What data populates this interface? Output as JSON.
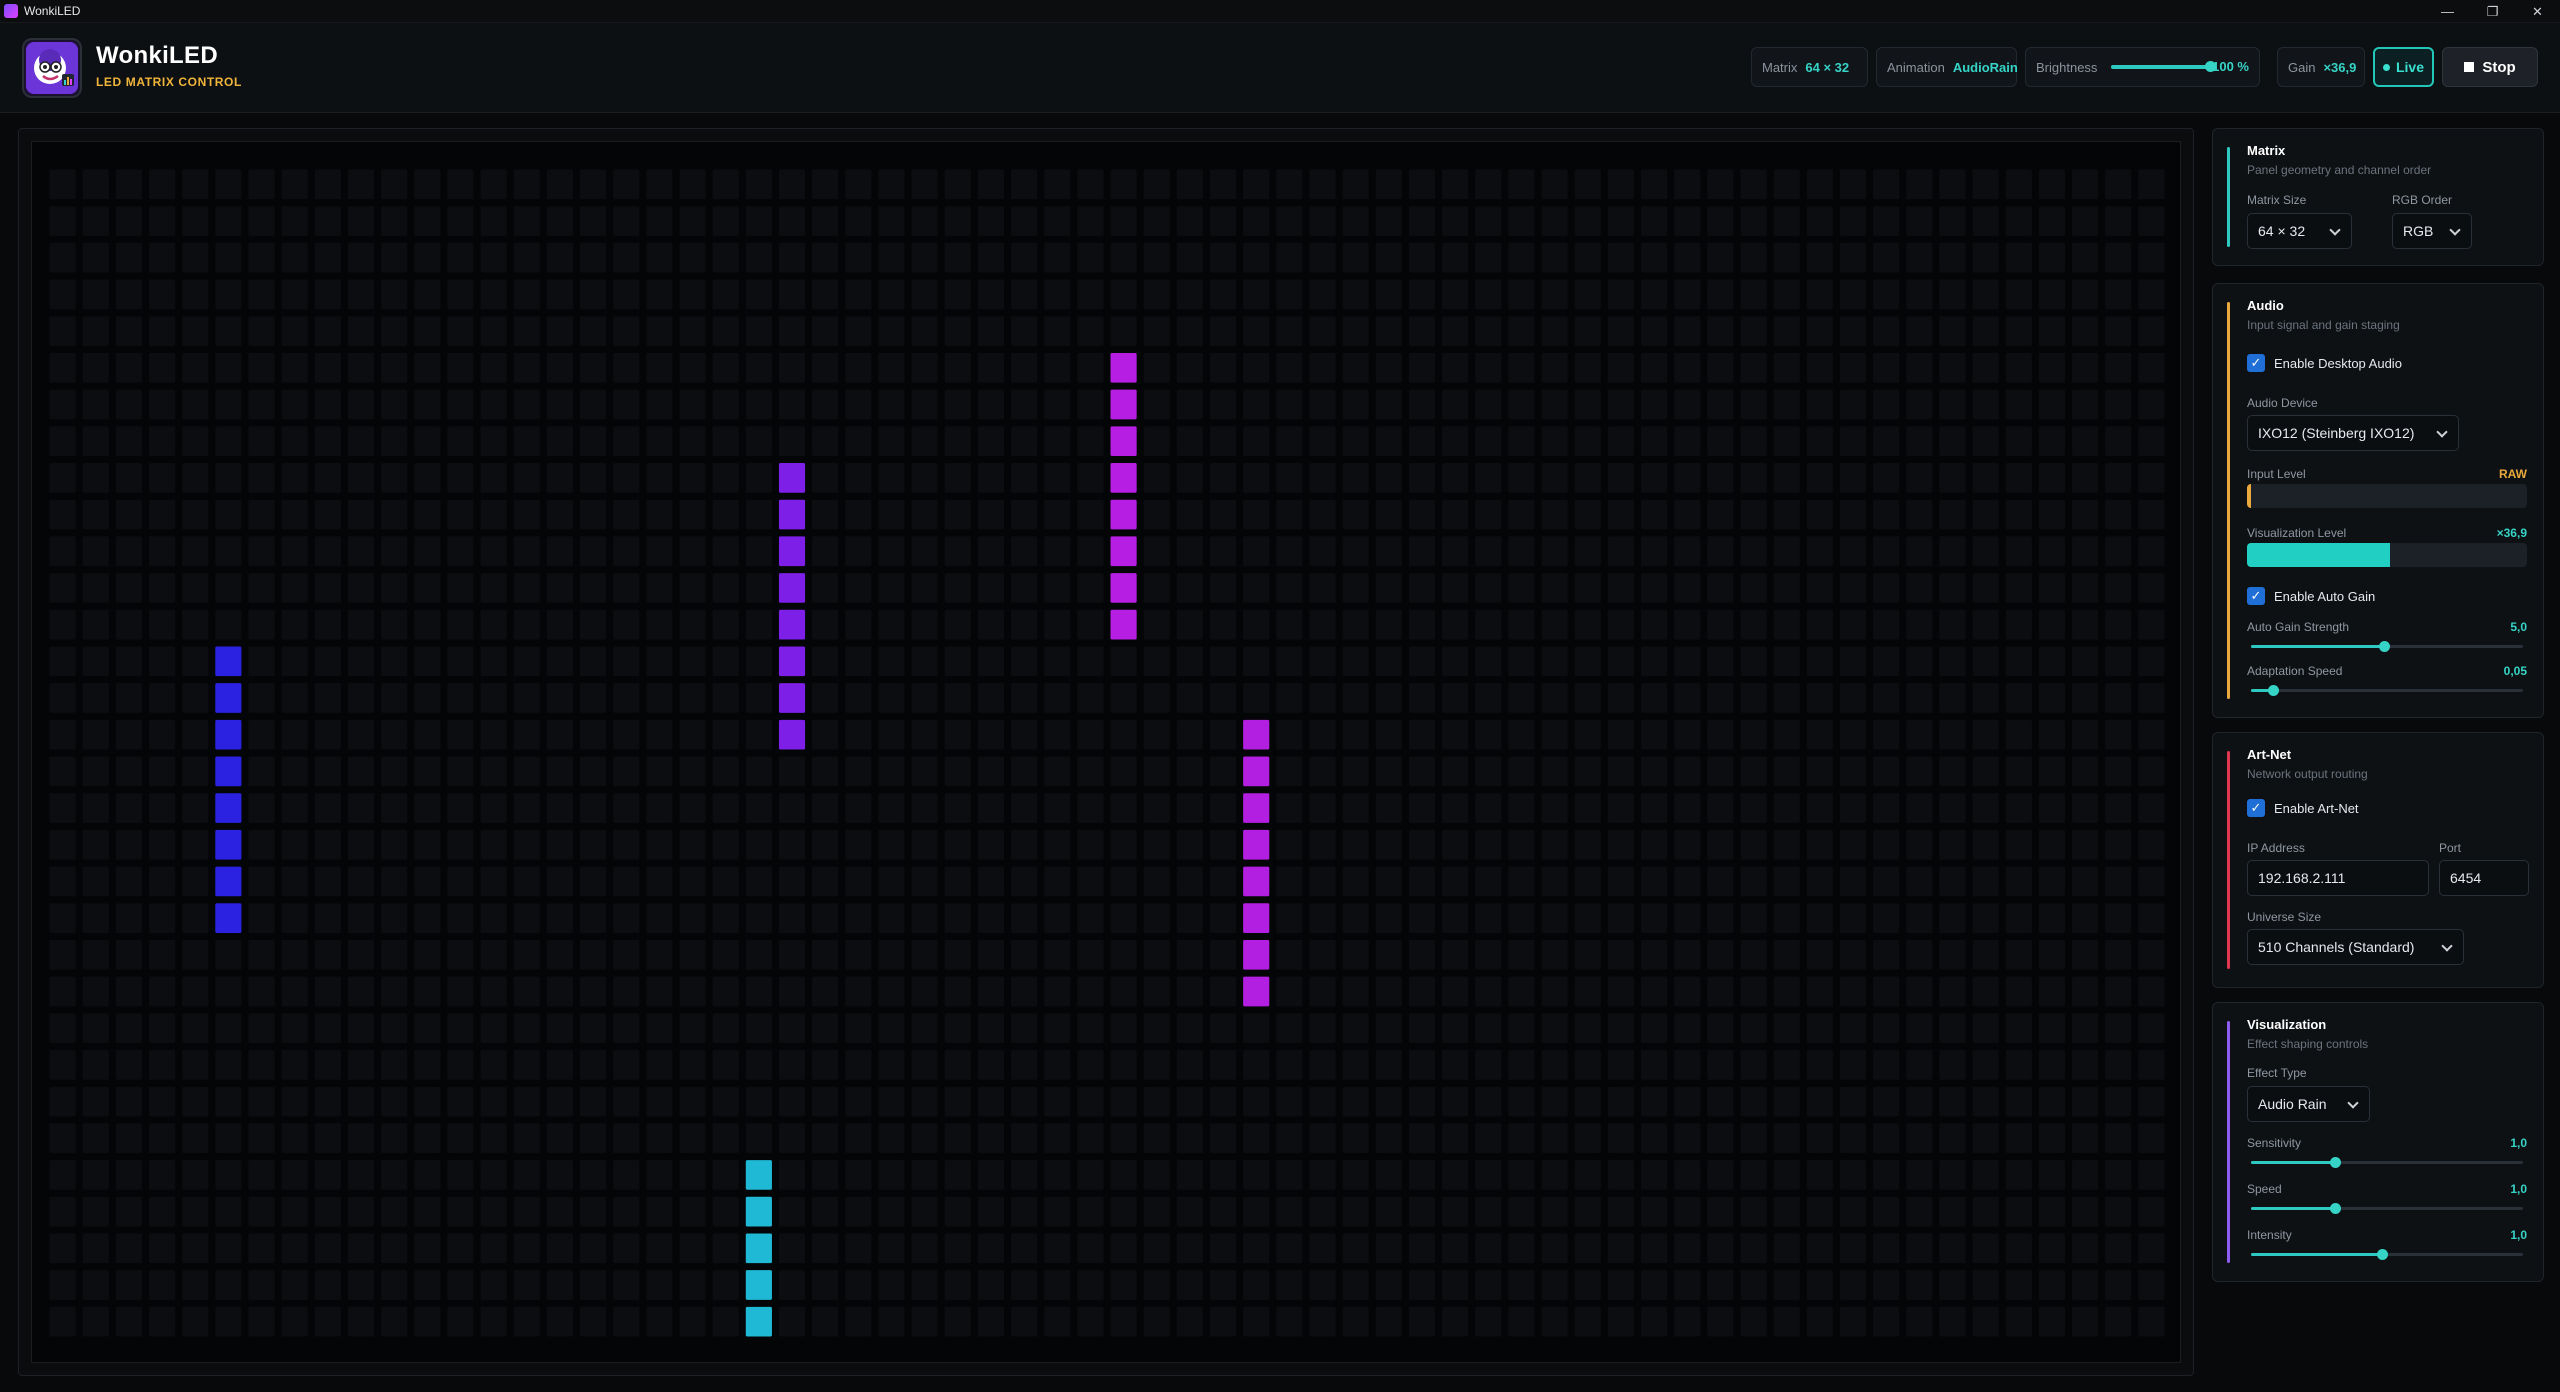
{
  "window": {
    "title": "WonkiLED"
  },
  "brand": {
    "name": "WonkiLED",
    "subtitle": "LED MATRIX CONTROL"
  },
  "status": {
    "matrix": {
      "label": "Matrix",
      "value": "64 × 32"
    },
    "animation": {
      "label": "Animation",
      "value": "AudioRain"
    },
    "brightness": {
      "label": "Brightness",
      "value": "100 %",
      "level": 1.0
    },
    "gain": {
      "label": "Gain",
      "value": "×36,9"
    }
  },
  "buttons": {
    "live": "Live",
    "stop": "Stop"
  },
  "led_matrix": {
    "cols": 64,
    "rows": 32,
    "columns": [
      {
        "col": 5,
        "row_start": 13,
        "length": 8,
        "color": "#2a22e0"
      },
      {
        "col": 22,
        "row_start": 8,
        "length": 8,
        "color": "#7d1fe6"
      },
      {
        "col": 21,
        "row_start": 27,
        "length": 5,
        "color": "#1fb9d6"
      },
      {
        "col": 32,
        "row_start": 5,
        "length": 8,
        "color": "#b61fe3"
      },
      {
        "col": 36,
        "row_start": 15,
        "length": 8,
        "color": "#b21fe0"
      }
    ]
  },
  "matrix_card": {
    "title": "Matrix",
    "desc": "Panel geometry and channel order",
    "size_label": "Matrix Size",
    "size_value": "64 × 32",
    "rgb_label": "RGB Order",
    "rgb_value": "RGB",
    "accent": "#2ec9c0"
  },
  "audio_card": {
    "title": "Audio",
    "desc": "Input signal and gain staging",
    "enable_desktop_audio": "Enable Desktop Audio",
    "device_label": "Audio Device",
    "device_value": "IXO12 (Steinberg IXO12)",
    "input_level_label": "Input Level",
    "input_level_value": "RAW",
    "input_level": 0.01,
    "vis_level_label": "Visualization Level",
    "vis_level_value": "×36,9",
    "vis_level": 0.51,
    "enable_auto_gain": "Enable Auto Gain",
    "auto_gain_label": "Auto Gain Strength",
    "auto_gain_value": "5,0",
    "auto_gain_level": 0.49,
    "adapt_label": "Adaptation Speed",
    "adapt_value": "0,05",
    "adapt_level": 0.08,
    "accent": "#e9a93c"
  },
  "artnet_card": {
    "title": "Art-Net",
    "desc": "Network output routing",
    "enable_artnet": "Enable Art-Net",
    "ip_label": "IP Address",
    "ip_value": "192.168.2.111",
    "port_label": "Port",
    "port_value": "6454",
    "universe_label": "Universe Size",
    "universe_value": "510 Channels (Standard)",
    "accent": "#e0364f"
  },
  "vis_card": {
    "title": "Visualization",
    "desc": "Effect shaping controls",
    "effect_label": "Effect Type",
    "effect_value": "Audio Rain",
    "sensitivity_label": "Sensitivity",
    "sensitivity_value": "1,0",
    "sensitivity_level": 0.31,
    "speed_label": "Speed",
    "speed_value": "1,0",
    "speed_level": 0.31,
    "intensity_label": "Intensity",
    "intensity_value": "1,0",
    "intensity_level": 0.48,
    "accent": "#8d5cf0"
  }
}
